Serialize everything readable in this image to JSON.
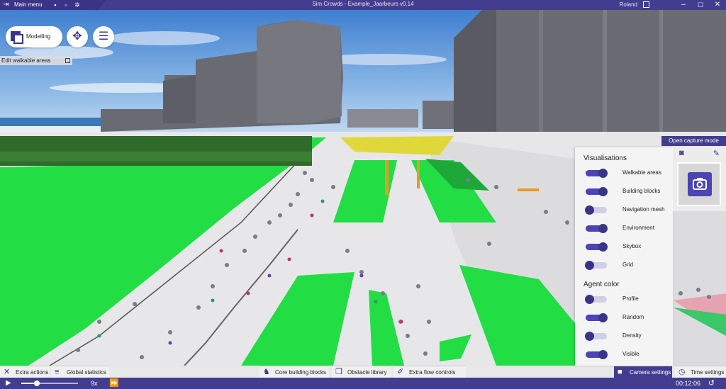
{
  "window": {
    "title": "Sim Crowds - Example_Jaarbeurs v0.14",
    "user": "Roland",
    "menu_label": "Main menu",
    "minimize": "–",
    "maximize": "☐",
    "close": "✕"
  },
  "toolbar": {
    "mode_label": "Modelling",
    "edit_walkable_label": "Edit walkable areas"
  },
  "capture": {
    "tab_label": "Open capture mode"
  },
  "visualisations": {
    "heading": "Visualisations",
    "items": [
      {
        "label": "Walkable areas",
        "on": true
      },
      {
        "label": "Building blocks",
        "on": true
      },
      {
        "label": "Navigation mesh",
        "on": false
      },
      {
        "label": "Environment",
        "on": true
      },
      {
        "label": "Skybox",
        "on": true
      },
      {
        "label": "Grid",
        "on": false
      }
    ]
  },
  "agent_color": {
    "heading": "Agent color",
    "items": [
      {
        "label": "Profile",
        "on": false
      },
      {
        "label": "Random",
        "on": true
      },
      {
        "label": "Density",
        "on": false
      },
      {
        "label": "Visible",
        "on": true
      }
    ]
  },
  "bottom_tabs": {
    "extra_actions": "Extra actions",
    "global_statistics": "Global statistics",
    "core_building_blocks": "Core building blocks",
    "obstacle_library": "Obstacle library",
    "extra_flow_controls": "Extra flow controls",
    "camera_settings": "Camera settings",
    "time_settings": "Time settings"
  },
  "timebar": {
    "speed": "9x",
    "clock": "00:12:06",
    "progress": 0.28
  },
  "colors": {
    "accent": "#433d8f",
    "toggle_on": "#4a44b4",
    "grass": "#22dd44",
    "path": "#ececec"
  }
}
